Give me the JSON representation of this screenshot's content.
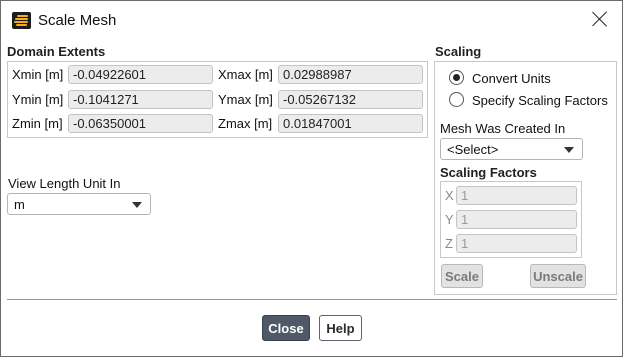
{
  "window": {
    "title": "Scale Mesh",
    "app_icon": "fluent-logo-icon",
    "close_icon": "close-icon"
  },
  "domain_extents": {
    "title": "Domain Extents",
    "fields": [
      {
        "label": "Xmin [m]",
        "value": "-0.04922601"
      },
      {
        "label": "Xmax [m]",
        "value": "0.02988987"
      },
      {
        "label": "Ymin [m]",
        "value": "-0.1041271"
      },
      {
        "label": "Ymax [m]",
        "value": "-0.05267132"
      },
      {
        "label": "Zmin [m]",
        "value": "-0.06350001"
      },
      {
        "label": "Zmax [m]",
        "value": "0.01847001"
      }
    ]
  },
  "view_length": {
    "label": "View Length Unit In",
    "selected": "m"
  },
  "scaling": {
    "title": "Scaling",
    "options": [
      {
        "label": "Convert Units",
        "checked": true
      },
      {
        "label": "Specify Scaling Factors",
        "checked": false
      }
    ],
    "mesh_created_label": "Mesh Was Created In",
    "mesh_created_selected": "<Select>",
    "factors_title": "Scaling Factors",
    "factors": [
      {
        "axis": "X",
        "value": "1"
      },
      {
        "axis": "Y",
        "value": "1"
      },
      {
        "axis": "Z",
        "value": "1"
      }
    ],
    "scale_label": "Scale",
    "unscale_label": "Unscale"
  },
  "footer": {
    "close_label": "Close",
    "help_label": "Help"
  },
  "colors": {
    "primary_button": "#4f5a66",
    "app_icon_accent": "#f0b01e"
  }
}
